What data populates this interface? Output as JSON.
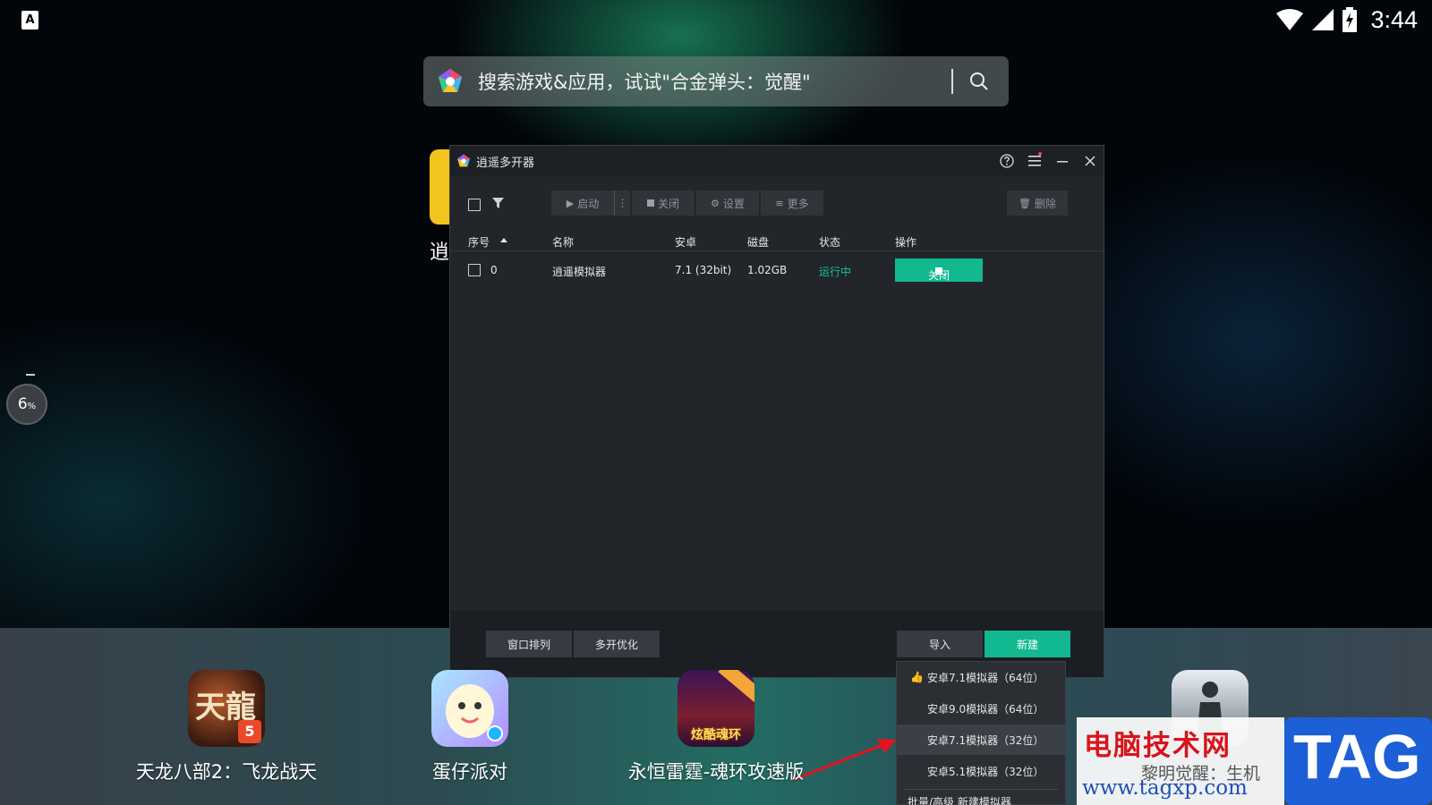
{
  "status_bar": {
    "notification_glyph": "A",
    "time": "3:44"
  },
  "search": {
    "placeholder": "搜索游戏&应用，试试\"合金弹头：觉醒\""
  },
  "side": {
    "partial_text": "逍",
    "progress_value": "6",
    "progress_unit": "%"
  },
  "manager": {
    "title": "逍遥多开器",
    "toolbar": {
      "start": "启动",
      "more_dots": "⋮",
      "close": "关闭",
      "settings": "设置",
      "more": "更多",
      "delete": "删除"
    },
    "table": {
      "headers": {
        "index": "序号",
        "name": "名称",
        "android": "安卓",
        "disk": "磁盘",
        "status": "状态",
        "action": "操作"
      },
      "rows": [
        {
          "index": "0",
          "name": "逍遥模拟器",
          "android": "7.1 (32bit)",
          "disk": "1.02GB",
          "status": "运行中",
          "action_label": "关闭"
        }
      ]
    },
    "footer": {
      "arrange": "窗口排列",
      "optimize": "多开优化",
      "import": "导入",
      "new": "新建"
    }
  },
  "dropdown": {
    "items": [
      "安卓7.1模拟器（64位）",
      "安卓9.0模拟器（64位）",
      "安卓7.1模拟器（32位）",
      "安卓5.1模拟器（32位）",
      "批量/高级 新建模拟器"
    ]
  },
  "dock": {
    "apps": [
      {
        "label": "天龙八部2：飞龙战天",
        "icon_text": "天龍"
      },
      {
        "label": "蛋仔派对",
        "icon_text": ""
      },
      {
        "label": "永恒雷霆-魂环攻速版",
        "icon_text": "炫酷魂环"
      }
    ]
  },
  "watermark": {
    "title": "电脑技术网",
    "subtitle": "黎明觉醒：生机",
    "url": "www.tagxp.com",
    "tag": "TAG"
  },
  "colors": {
    "accent_green": "#12b88f",
    "running_green": "#16c29a",
    "watermark_red": "#d8141c",
    "watermark_blue": "#1d5fd6"
  }
}
